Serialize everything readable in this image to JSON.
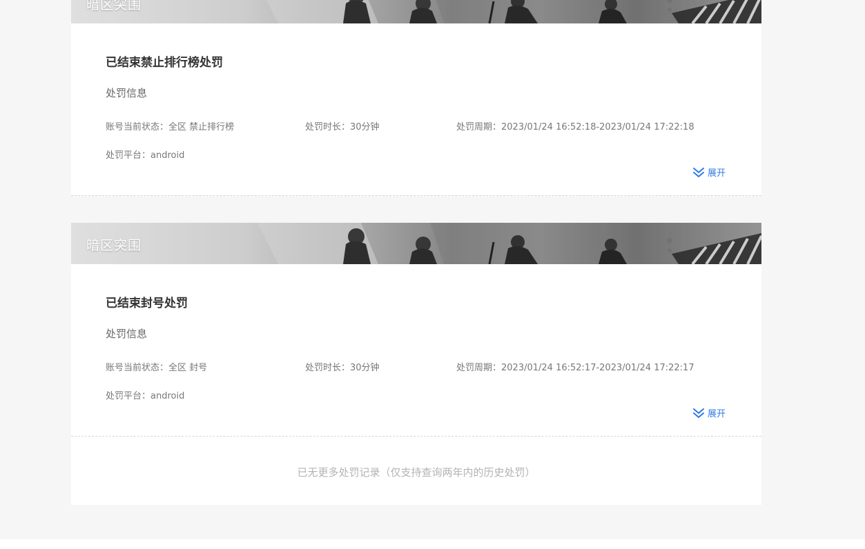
{
  "records": [
    {
      "banner_title": "暗区突围",
      "title": "已结束禁止排行榜处罚",
      "section_label": "处罚信息",
      "status_label": "账号当前状态：",
      "status_value": "全区 禁止排行榜",
      "duration_label": "处罚时长：",
      "duration_value": "30分钟",
      "period_label": "处罚周期：",
      "period_value": "2023/01/24 16:52:18-2023/01/24 17:22:18",
      "platform_label": "处罚平台：",
      "platform_value": "android",
      "expand_label": "展开",
      "expand_icon": "double-chevron-down-icon"
    },
    {
      "banner_title": "暗区突围",
      "title": "已结束封号处罚",
      "section_label": "处罚信息",
      "status_label": "账号当前状态：",
      "status_value": "全区 封号",
      "duration_label": "处罚时长：",
      "duration_value": "30分钟",
      "period_label": "处罚周期：",
      "period_value": "2023/01/24 16:52:17-2023/01/24 17:22:17",
      "platform_label": "处罚平台：",
      "platform_value": "android",
      "expand_label": "展开",
      "expand_icon": "double-chevron-down-icon"
    }
  ],
  "footer_text": "已无更多处罚记录（仅支持查询两年内的历史处罚）",
  "colors": {
    "accent": "#2c7be5",
    "page_background": "#f6f6f6"
  }
}
